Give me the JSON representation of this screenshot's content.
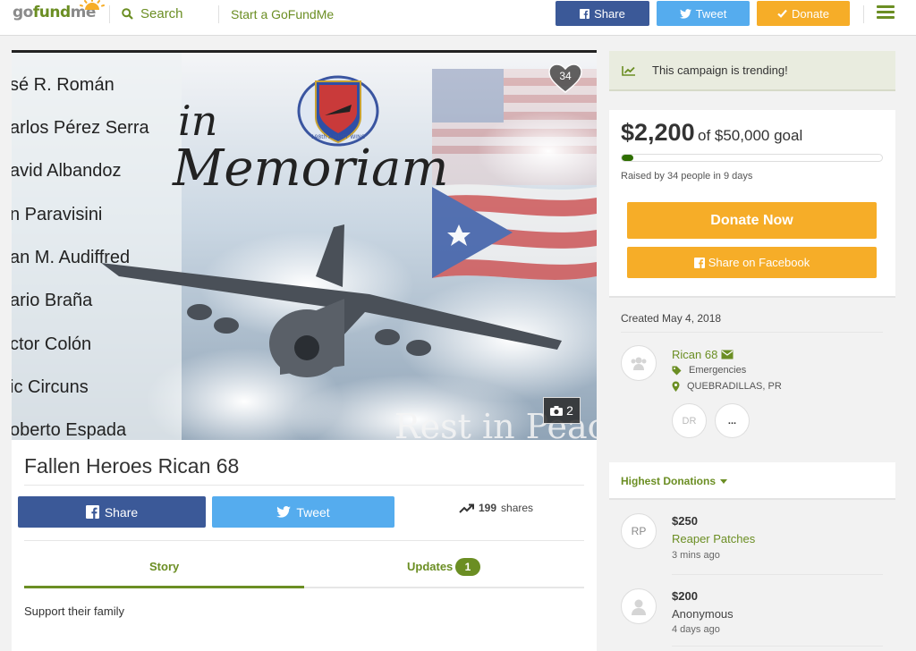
{
  "header": {
    "logo_prefix": "go",
    "logo_fund": "fund",
    "logo_suffix": "me",
    "search_label": "Search",
    "start_label": "Start a GoFundMe",
    "share_label": "Share",
    "tweet_label": "Tweet",
    "donate_label": "Donate",
    "menu_icon": "hamburger-icon"
  },
  "hero": {
    "names": [
      "sé R. Román",
      "arlos Pérez Serra",
      "avid Albandoz",
      "n Paravisini",
      "an M. Audiffred",
      "ario Braña",
      "ctor Colón",
      "ic Circuns",
      "oberto Espada"
    ],
    "headline_small": "in",
    "headline_large": "Memoriam",
    "seal_text": "198th AIRLIFT WING",
    "footer_text": "Rest in Peac",
    "heart_count": "34",
    "photo_count": "2"
  },
  "campaign": {
    "title": "Fallen Heroes Rican 68",
    "share_label": "Share",
    "tweet_label": "Tweet",
    "shares_count": "199",
    "shares_label": "shares",
    "tab_story": "Story",
    "tab_updates": "Updates",
    "updates_count": "1",
    "story_text": "Support their family"
  },
  "sidebar": {
    "trending_text": "This campaign is trending!",
    "raised_amount": "$2,200",
    "goal_text": "of $50,000 goal",
    "progress_fraction": 0.044,
    "raised_by": "Raised by 34 people in 9 days",
    "donate_now_label": "Donate Now",
    "share_fb_label": "Share on Facebook",
    "created": "Created May 4, 2018",
    "organizer_name": "Rican 68",
    "category": "Emergencies",
    "location": "QUEBRADILLAS, PR",
    "team_initials": "DR",
    "team_more": "...",
    "highest_donations": "Highest Donations",
    "donations": [
      {
        "initials": "RP",
        "amount": "$250",
        "name": "Reaper Patches",
        "time": "3 mins ago"
      },
      {
        "initials": "",
        "amount": "$200",
        "name": "Anonymous",
        "time": "4 days ago"
      }
    ]
  },
  "colors": {
    "brand_green": "#6b8e23",
    "facebook": "#3b5998",
    "twitter": "#55acee",
    "donate_orange": "#f6ad28"
  }
}
